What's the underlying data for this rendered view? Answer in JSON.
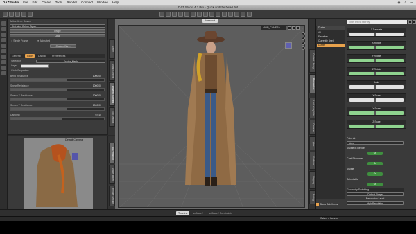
{
  "menubar": {
    "app": "DAZStudio",
    "items": [
      "File",
      "Edit",
      "Create",
      "Tools",
      "Render",
      "Connect",
      "Window",
      "Help"
    ]
  },
  "window": {
    "title": "DAZ Studio 4.7 Pro - Quick and the Dead.duf"
  },
  "left_panel": {
    "header": "Active Item: Duster",
    "dropdown": "Dist. sim. Ctrl on Figure",
    "buttons": [
      "Drape",
      "Clear",
      "Custom Wiz..."
    ],
    "single_frame": "Single Frame",
    "animated": "Animated",
    "tabs": [
      "General",
      "Cloth",
      "Display",
      "Preferences"
    ],
    "section": "Selection",
    "section_value": "Duster_Mesh",
    "layer_label": "Layer",
    "cloth_properties": "Cloth Properties",
    "sliders": [
      {
        "label": "Bend Resistance",
        "value": "1000.00",
        "fill": 0.6
      },
      {
        "label": "Shear Resistance",
        "value": "1000.00",
        "fill": 0.6
      },
      {
        "label": "Stretch X Resistance",
        "value": "1000.00",
        "fill": 0.6
      },
      {
        "label": "Stretch Y Resistance",
        "value": "1000.00",
        "fill": 0.6
      },
      {
        "label": "Damping",
        "value": "0.010",
        "fill": 0.55
      }
    ]
  },
  "left_tabs": [
    "Scene",
    "Smart Content",
    "Dynamic Clothing",
    "Tool Settings"
  ],
  "aux_viewport": {
    "camera": "Default Camera",
    "tabs": [
      "Aux Viewport",
      "Shader Baker",
      "Render Settings"
    ]
  },
  "viewport": {
    "tab": "Viewport",
    "camera": "MAIN_CAMERA"
  },
  "right_panel": {
    "search_placeholder": "Enter text to filter by",
    "scene_list": [
      {
        "label": "All",
        "selected": false
      },
      {
        "label": "Favorites",
        "selected": false
      },
      {
        "label": "Currently Used",
        "selected": false
      },
      {
        "label": "Duster",
        "selected": true
      }
    ],
    "params": [
      {
        "name": "Z Translate",
        "green": false,
        "knob": 0.45
      },
      {
        "name": "X Rotate",
        "green": true,
        "knob": 0.45
      },
      {
        "name": "Y Rotate",
        "green": true,
        "knob": 0.45
      },
      {
        "name": "Z Rotate",
        "green": true,
        "knob": 0.45
      },
      {
        "name": "Scale",
        "green": false,
        "knob": 0.45
      },
      {
        "name": "X Scale",
        "green": false,
        "knob": 0.45
      },
      {
        "name": "Y Scale",
        "green": true,
        "knob": 0.45
      },
      {
        "name": "Z Scale",
        "green": true,
        "knob": 0.45
      }
    ],
    "point_at": "Point At",
    "point_at_value": "None",
    "visible_in_render": "Visible in Render",
    "cast_shadows": "Cast Shadows",
    "visible": "Visible",
    "selectable": "Selectable",
    "on_label": "On",
    "geometry_switching": "Geometry Switching",
    "resolution_level": "Resolution Level",
    "resolution_value": "High Resolution",
    "show_sub_items": "Show Sub Items",
    "right_tabs": [
      "Content Library",
      "Parameters",
      "Posing",
      "Shaping",
      "Surfaces",
      "Lights",
      "Cameras",
      "Tool Settings",
      "Look at my Hair"
    ]
  },
  "bottom_tabs": [
    "Timeline",
    "aniMate2",
    "aniMate2 Constraints"
  ],
  "status": {
    "lesson": "Select a Lesson..."
  }
}
